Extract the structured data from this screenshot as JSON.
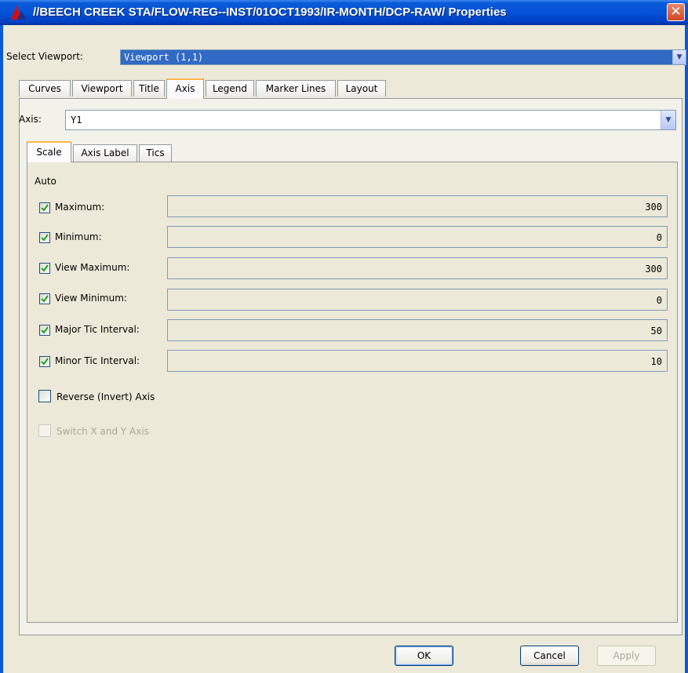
{
  "window": {
    "title": "//BEECH CREEK STA/FLOW-REG--INST/01OCT1993/IR-MONTH/DCP-RAW/ Properties",
    "close_glyph": "✕"
  },
  "viewport": {
    "label": "Select Viewport:",
    "selected": "Viewport (1,1)"
  },
  "tabs": [
    "Curves",
    "Viewport",
    "Title",
    "Axis",
    "Legend",
    "Marker Lines",
    "Layout"
  ],
  "active_tab": "Axis",
  "axis": {
    "label": "Axis:",
    "selected": "Y1"
  },
  "subtabs": [
    "Scale",
    "Axis Label",
    "Tics"
  ],
  "active_subtab": "Scale",
  "scale": {
    "auto_label": "Auto",
    "rows": [
      {
        "label": "Maximum:",
        "checked": true,
        "value": "300"
      },
      {
        "label": "Minimum:",
        "checked": true,
        "value": "0"
      },
      {
        "label": "View Maximum:",
        "checked": true,
        "value": "300"
      },
      {
        "label": "View Minimum:",
        "checked": true,
        "value": "0"
      },
      {
        "label": "Major Tic Interval:",
        "checked": true,
        "value": "50"
      },
      {
        "label": "Minor Tic Interval:",
        "checked": true,
        "value": "10"
      }
    ],
    "reverse_axis": {
      "label": "Reverse (Invert) Axis",
      "checked": false
    },
    "switch_axis": {
      "label": "Switch X and Y Axis",
      "checked": false,
      "enabled": false
    }
  },
  "buttons": {
    "ok": "OK",
    "cancel": "Cancel",
    "apply": "Apply"
  },
  "colors": {
    "titlebar": "#0452d6",
    "selection": "#316ac5",
    "active_tab_accent": "#f9b84a",
    "check": "#21a121"
  }
}
